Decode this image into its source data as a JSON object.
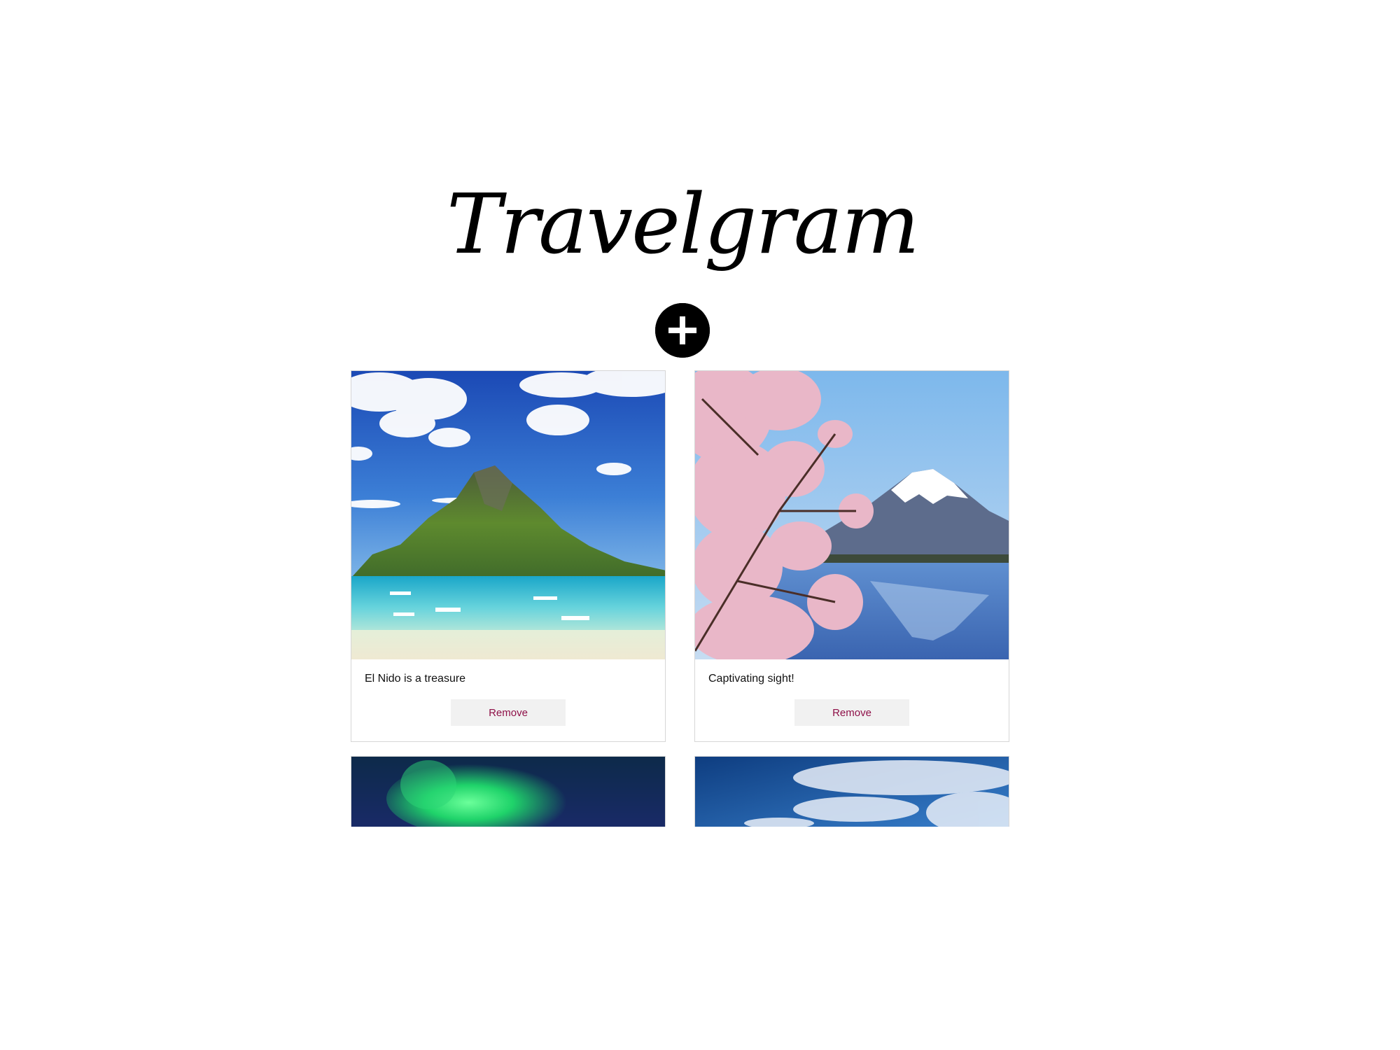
{
  "app": {
    "title": "Travelgram"
  },
  "add_button": {
    "icon": "plus-circle-icon"
  },
  "posts": [
    {
      "caption": "El Nido is a treasure",
      "remove_label": "Remove",
      "image": "tropical-island-photo"
    },
    {
      "caption": "Captivating sight!",
      "remove_label": "Remove",
      "image": "mount-fuji-cherry-blossom-photo"
    },
    {
      "image": "aurora-borealis-photo"
    },
    {
      "image": "blue-sky-clouds-photo"
    }
  ],
  "colors": {
    "remove_text": "#8e1048",
    "remove_bg": "#f1f1f1",
    "card_border": "#d6d6d6"
  }
}
